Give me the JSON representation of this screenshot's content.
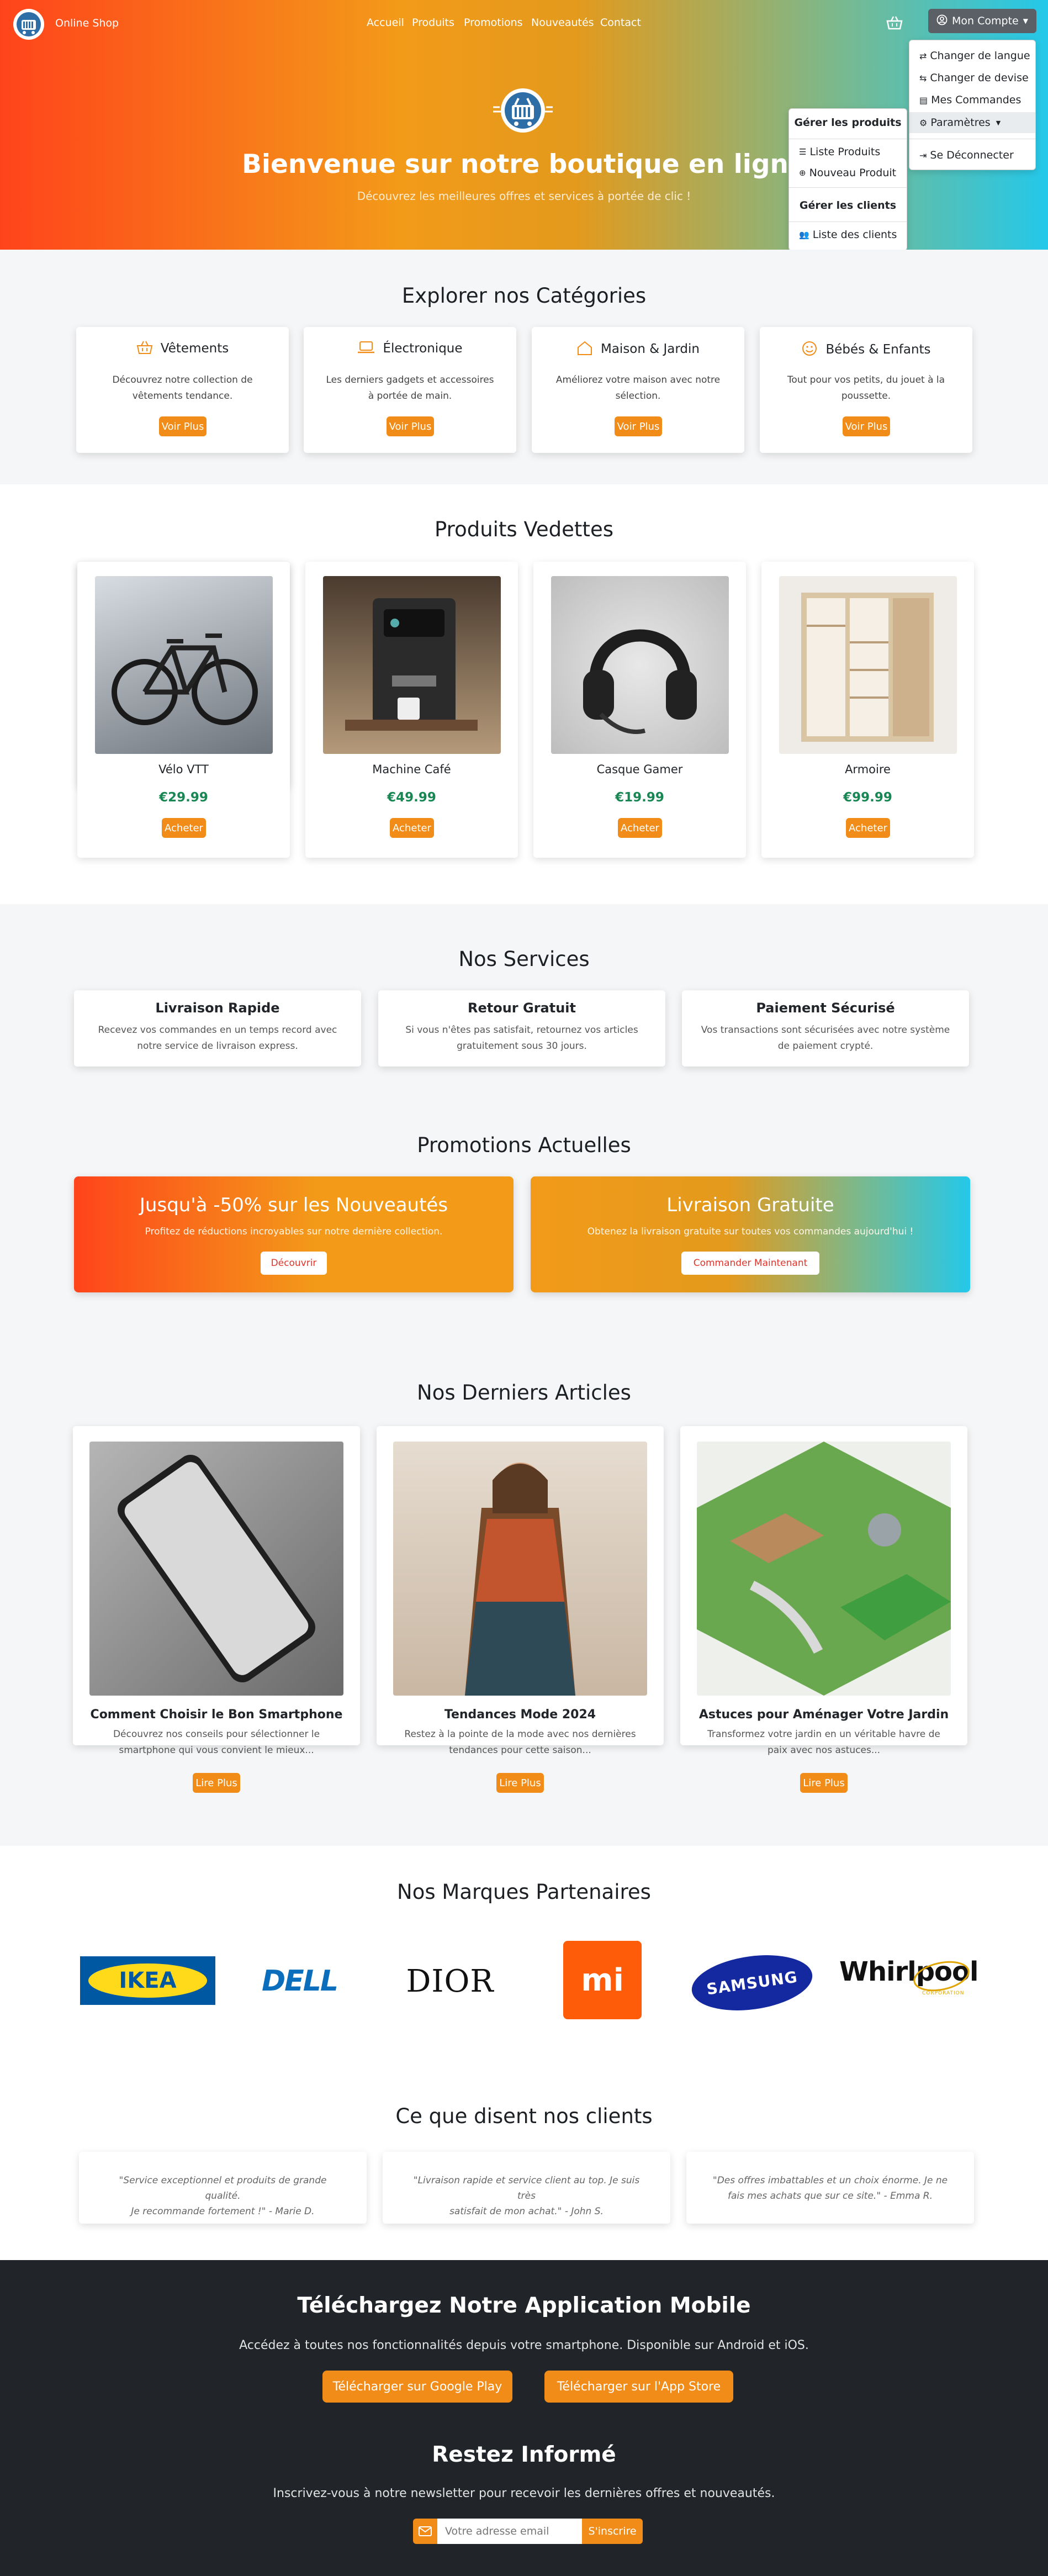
{
  "nav": {
    "brand": "Online Shop",
    "links": [
      "Accueil",
      "Produits",
      "Promotions",
      "Nouveautés",
      "Contact"
    ],
    "account_label": "Mon Compte"
  },
  "account_menu": {
    "items": [
      "Changer de langue",
      "Changer de devise",
      "Mes Commandes",
      "Paramètres",
      "Se Déconnecter"
    ]
  },
  "admin_menu": {
    "products_header": "Gérer les produits",
    "products_items": [
      "Liste Produits",
      "Nouveau Produit"
    ],
    "clients_header": "Gérer les clients",
    "clients_items": [
      "Liste des clients"
    ]
  },
  "hero": {
    "title": "Bienvenue sur notre boutique en ligne",
    "subtitle": "Découvrez les meilleures offres et services à portée de clic !"
  },
  "categories": {
    "title": "Explorer nos Catégories",
    "items": [
      {
        "name": "Vêtements",
        "desc1": "Découvrez notre collection de",
        "desc2": "vêtements tendance.",
        "btn": "Voir Plus",
        "icon": "basket-icon"
      },
      {
        "name": "Électronique",
        "desc1": "Les derniers gadgets et accessoires",
        "desc2": "à portée de main.",
        "btn": "Voir Plus",
        "icon": "laptop-icon"
      },
      {
        "name": "Maison & Jardin",
        "desc1": "Améliorez votre maison avec notre",
        "desc2": "sélection.",
        "btn": "Voir Plus",
        "icon": "house-icon"
      },
      {
        "name": "Bébés & Enfants",
        "desc1": "Tout pour vos petits, du jouet à la",
        "desc2": "poussette.",
        "btn": "Voir Plus",
        "icon": "smile-icon"
      }
    ]
  },
  "featured": {
    "title": "Produits Vedettes",
    "items": [
      {
        "name": "Vélo VTT",
        "price": "€29.99",
        "btn": "Acheter"
      },
      {
        "name": "Machine Café",
        "price": "€49.99",
        "btn": "Acheter"
      },
      {
        "name": "Casque Gamer",
        "price": "€19.99",
        "btn": "Acheter"
      },
      {
        "name": "Armoire",
        "price": "€99.99",
        "btn": "Acheter"
      }
    ]
  },
  "services": {
    "title": "Nos Services",
    "items": [
      {
        "name": "Livraison Rapide",
        "desc1": "Recevez vos commandes en un temps record avec",
        "desc2": "notre service de livraison express."
      },
      {
        "name": "Retour Gratuit",
        "desc1": "Si vous n'êtes pas satisfait, retournez vos articles",
        "desc2": "gratuitement sous 30 jours."
      },
      {
        "name": "Paiement Sécurisé",
        "desc1": "Vos transactions sont sécurisées avec notre système",
        "desc2": "de paiement crypté."
      }
    ]
  },
  "promotions": {
    "title": "Promotions Actuelles",
    "items": [
      {
        "name": "Jusqu'à -50% sur les Nouveautés",
        "desc": "Profitez de réductions incroyables sur notre dernière collection.",
        "btn": "Découvrir"
      },
      {
        "name": "Livraison Gratuite",
        "desc": "Obtenez la livraison gratuite sur toutes vos commandes aujourd'hui !",
        "btn": "Commander Maintenant"
      }
    ]
  },
  "articles": {
    "title": "Nos Derniers Articles",
    "items": [
      {
        "name": "Comment Choisir le Bon Smartphone",
        "desc1": "Découvrez nos conseils pour sélectionner le",
        "desc2": "smartphone qui vous convient le mieux...",
        "btn": "Lire Plus"
      },
      {
        "name": "Tendances Mode 2024",
        "desc1": "Restez à la pointe de la mode avec nos dernières",
        "desc2": "tendances pour cette saison...",
        "btn": "Lire Plus"
      },
      {
        "name": "Astuces pour Aménager Votre Jardin",
        "desc1": "Transformez votre jardin en un véritable havre de",
        "desc2": "paix avec nos astuces...",
        "btn": "Lire Plus"
      }
    ]
  },
  "brands": {
    "title": "Nos Marques Partenaires",
    "items": [
      "IKEA",
      "DELL",
      "DIOR",
      "mi",
      "SAMSUNG",
      "Whirlpool"
    ],
    "whirlpool_sub": "CORPORATION"
  },
  "testimonials": {
    "title": "Ce que disent nos clients",
    "items": [
      {
        "l1": "\"Service exceptionnel et produits de grande qualité.",
        "l2": "Je recommande fortement !\" - Marie D."
      },
      {
        "l1": "\"Livraison rapide et service client au top. Je suis très",
        "l2": "satisfait de mon achat.\" - John S."
      },
      {
        "l1": "\"Des offres imbattables et un choix énorme. Je ne",
        "l2": "fais mes achats que sur ce site.\" - Emma R."
      }
    ]
  },
  "app": {
    "title": "Téléchargez Notre Application Mobile",
    "desc": "Accédez à toutes nos fonctionnalités depuis votre smartphone. Disponible sur Android et iOS.",
    "google_btn": "Télécharger sur Google Play",
    "apple_btn": "Télécharger sur l'App Store"
  },
  "newsletter": {
    "title": "Restez Informé",
    "desc": "Inscrivez-vous à notre newsletter pour recevoir les dernières offres et nouveautés.",
    "placeholder": "Votre adresse email",
    "btn": "S'inscrire"
  },
  "colors": {
    "accent": "#f28c18",
    "price": "#198754",
    "footer": "#212529"
  }
}
